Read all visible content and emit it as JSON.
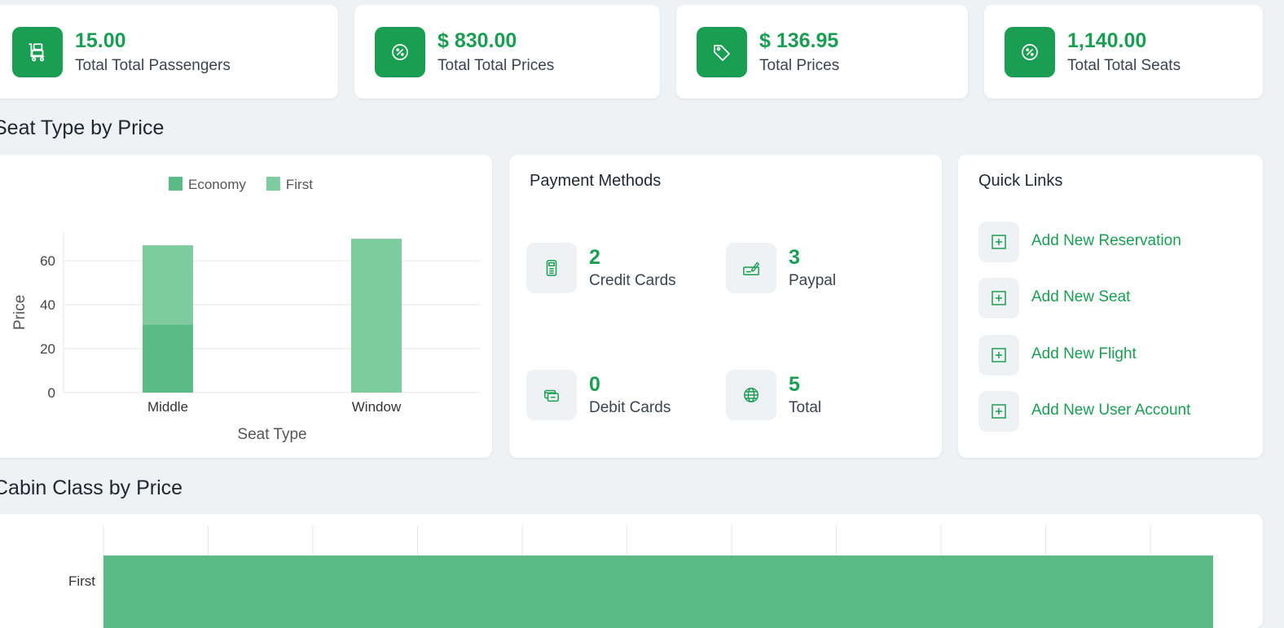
{
  "stats": [
    {
      "value": "15.00",
      "label": "Total Total Passengers",
      "icon": "luggage-cart-icon"
    },
    {
      "value": "$ 830.00",
      "label": "Total Total Prices",
      "icon": "percent-badge-icon"
    },
    {
      "value": "$ 136.95",
      "label": "Total Prices",
      "icon": "price-tag-icon"
    },
    {
      "value": "1,140.00",
      "label": "Total Total Seats",
      "icon": "percent-badge-icon"
    }
  ],
  "sections": {
    "seat_type_title": "Seat Type by Price",
    "cabin_class_title": "Cabin Class by Price"
  },
  "payment_methods": {
    "title": "Payment Methods",
    "items": [
      {
        "value": "2",
        "label": "Credit Cards",
        "icon": "credit-card-terminal-icon"
      },
      {
        "value": "3",
        "label": "Paypal",
        "icon": "cheque-signature-icon"
      },
      {
        "value": "0",
        "label": "Debit Cards",
        "icon": "card-swipe-icon"
      },
      {
        "value": "5",
        "label": "Total",
        "icon": "globe-icon"
      }
    ]
  },
  "quick_links": {
    "title": "Quick Links",
    "items": [
      {
        "label": "Add New Reservation",
        "icon": "plus-square-icon"
      },
      {
        "label": "Add New Seat",
        "icon": "plus-square-icon"
      },
      {
        "label": "Add New Flight",
        "icon": "plus-square-icon"
      },
      {
        "label": "Add New User Account",
        "icon": "plus-square-icon"
      }
    ]
  },
  "colors": {
    "accent": "#1a9e52",
    "economy": "#5bbb86",
    "first": "#7dcb9f",
    "background": "#eef2f5"
  },
  "chart_data": [
    {
      "type": "bar",
      "stacked": true,
      "categories": [
        "Middle",
        "Window"
      ],
      "series": [
        {
          "name": "Economy",
          "values": [
            31,
            0
          ]
        },
        {
          "name": "First",
          "values": [
            36,
            70
          ]
        }
      ],
      "xlabel": "Seat Type",
      "ylabel": "Price",
      "ylim": [
        0,
        73
      ],
      "yticks": [
        0,
        20,
        40,
        60
      ],
      "grid": true,
      "legend": "top-center"
    },
    {
      "type": "bar",
      "orientation": "horizontal",
      "categories": [
        "First"
      ],
      "values": [
        830
      ],
      "grid": true,
      "partially_visible": true
    }
  ]
}
